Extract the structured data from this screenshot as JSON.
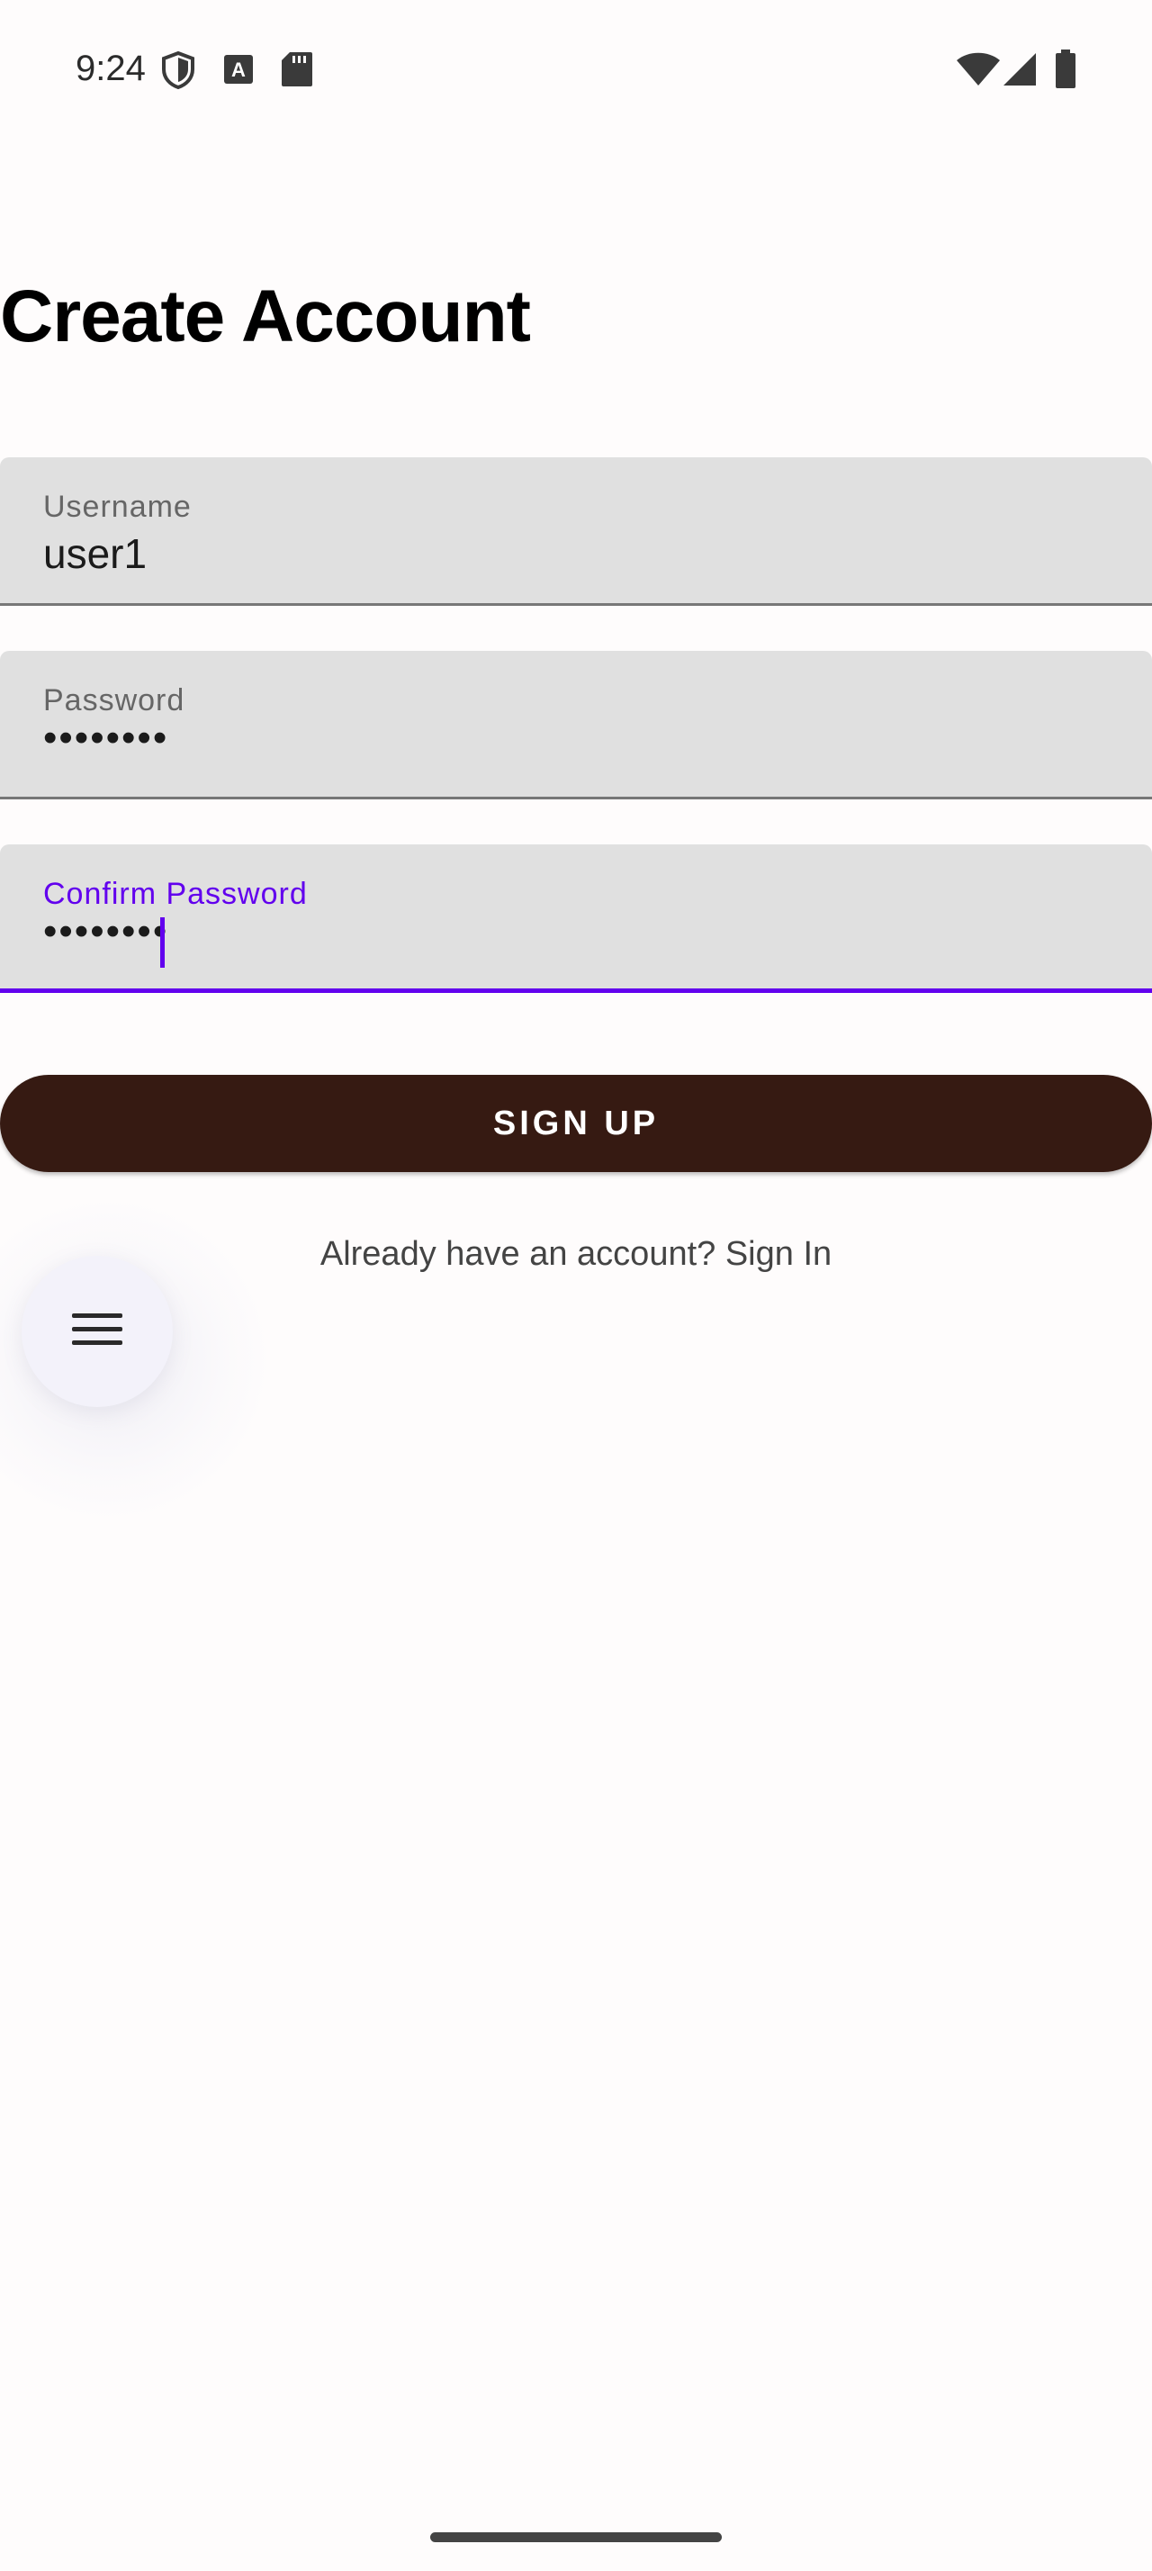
{
  "status_bar": {
    "time": "9:24",
    "icons_left": [
      "shield-icon",
      "text-a-icon",
      "sd-card-icon"
    ],
    "icons_right": [
      "wifi-icon",
      "cell-signal-icon",
      "battery-icon"
    ]
  },
  "page": {
    "title": "Create Account"
  },
  "form": {
    "username": {
      "label": "Username",
      "value": "user1"
    },
    "password": {
      "label": "Password",
      "value": "••••••••"
    },
    "confirm_password": {
      "label": "Confirm Password",
      "value": "••••••••",
      "focused": true
    },
    "signup_label": "SIGN UP",
    "signin_prompt": "Already have an account? Sign In"
  },
  "fab": {
    "icon": "menu-icon"
  },
  "colors": {
    "accent": "#6200ee",
    "button_bg": "#361a12",
    "field_bg": "#e0e0e0",
    "background": "#fefcfc"
  }
}
